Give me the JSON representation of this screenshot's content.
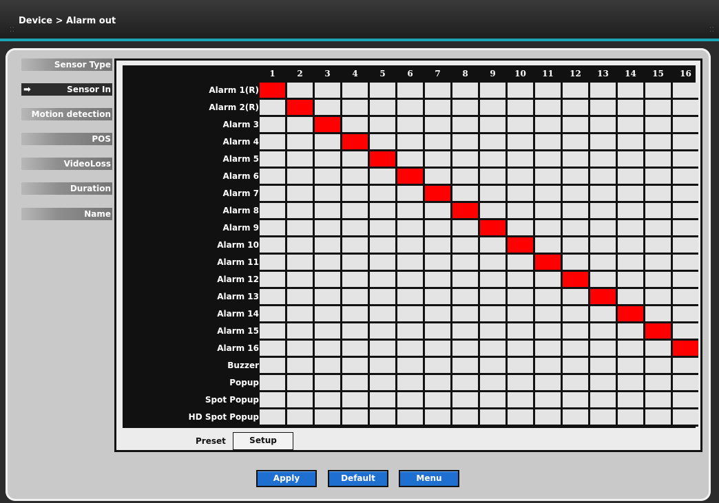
{
  "header": {
    "title": "Device > Alarm out"
  },
  "colors": {
    "accent": "#1aa6b7",
    "active_cell": "#ff0000",
    "button_blue": "#1f6fd0"
  },
  "sidebar": {
    "items": [
      {
        "label": "Sensor Type",
        "active": false
      },
      {
        "label": "Sensor In",
        "active": true
      },
      {
        "label": "Motion detection",
        "active": false
      },
      {
        "label": "POS",
        "active": false
      },
      {
        "label": "VideoLoss",
        "active": false
      },
      {
        "label": "Duration",
        "active": false
      },
      {
        "label": "Name",
        "active": false
      }
    ],
    "active_icon": "arrow-right-icon"
  },
  "matrix": {
    "columns": [
      "1",
      "2",
      "3",
      "4",
      "5",
      "6",
      "7",
      "8",
      "9",
      "10",
      "11",
      "12",
      "13",
      "14",
      "15",
      "16"
    ],
    "rows": [
      {
        "label": "Alarm 1(R)",
        "active_column": 1
      },
      {
        "label": "Alarm 2(R)",
        "active_column": 2
      },
      {
        "label": "Alarm 3",
        "active_column": 3
      },
      {
        "label": "Alarm 4",
        "active_column": 4
      },
      {
        "label": "Alarm 5",
        "active_column": 5
      },
      {
        "label": "Alarm 6",
        "active_column": 6
      },
      {
        "label": "Alarm 7",
        "active_column": 7
      },
      {
        "label": "Alarm 8",
        "active_column": 8
      },
      {
        "label": "Alarm 9",
        "active_column": 9
      },
      {
        "label": "Alarm 10",
        "active_column": 10
      },
      {
        "label": "Alarm 11",
        "active_column": 11
      },
      {
        "label": "Alarm 12",
        "active_column": 12
      },
      {
        "label": "Alarm 13",
        "active_column": 13
      },
      {
        "label": "Alarm 14",
        "active_column": 14
      },
      {
        "label": "Alarm 15",
        "active_column": 15
      },
      {
        "label": "Alarm 16",
        "active_column": 16
      },
      {
        "label": "Buzzer",
        "active_column": null
      },
      {
        "label": "Popup",
        "active_column": null
      },
      {
        "label": "Spot Popup",
        "active_column": null
      },
      {
        "label": "HD Spot Popup",
        "active_column": null
      }
    ]
  },
  "preset": {
    "label": "Preset",
    "setup_label": "Setup"
  },
  "actions": {
    "apply_label": "Apply",
    "default_label": "Default",
    "menu_label": "Menu"
  }
}
